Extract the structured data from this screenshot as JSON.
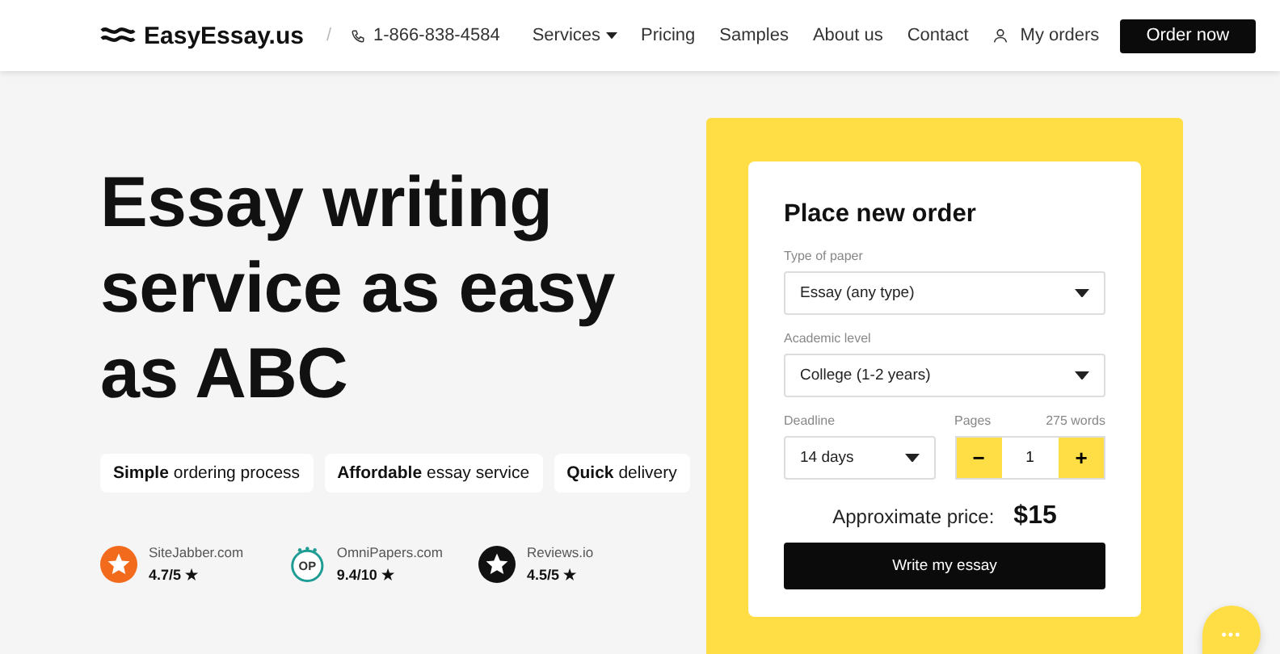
{
  "header": {
    "logo": "EasyEssay.us",
    "separator": "/",
    "phone": "1-866-838-4584",
    "nav": [
      {
        "label": "Services",
        "dropdown": true
      },
      {
        "label": "Pricing",
        "dropdown": false
      },
      {
        "label": "Samples",
        "dropdown": false
      },
      {
        "label": "About us",
        "dropdown": false
      },
      {
        "label": "Contact",
        "dropdown": false
      }
    ],
    "account": "My orders",
    "cta": "Order now"
  },
  "hero": {
    "title": "Essay writing service as easy as ABC",
    "features": [
      "**Simple** ordering process",
      "**Affordable** essay service",
      "**Quick** delivery"
    ],
    "ratings": [
      {
        "kind": "star",
        "color": "#f26a1b",
        "site": "SiteJabber.com",
        "score": "4.7/5 ★"
      },
      {
        "kind": "badge",
        "color": "#1f9c94",
        "logo_text": "OP",
        "site": "OmniPapers.com",
        "score": "9.4/10 ★"
      },
      {
        "kind": "star",
        "color": "#111111",
        "site": "Reviews.io",
        "score": "4.5/5 ★"
      }
    ]
  },
  "order": {
    "title": "Place new order",
    "fields": [
      {
        "label": "Type of paper",
        "value": "Essay (any type)"
      },
      {
        "label": "Academic level",
        "value": "College (1-2 years)"
      }
    ],
    "deadline": {
      "label": "Deadline",
      "value": "14 days"
    },
    "pages": {
      "label": "Pages",
      "note": "275 words",
      "minus": "−",
      "value": "1",
      "plus": "+"
    },
    "price_label": "Approximate price:",
    "price": "$15",
    "submit": "Write my essay"
  },
  "chat": {
    "label": "•••"
  }
}
